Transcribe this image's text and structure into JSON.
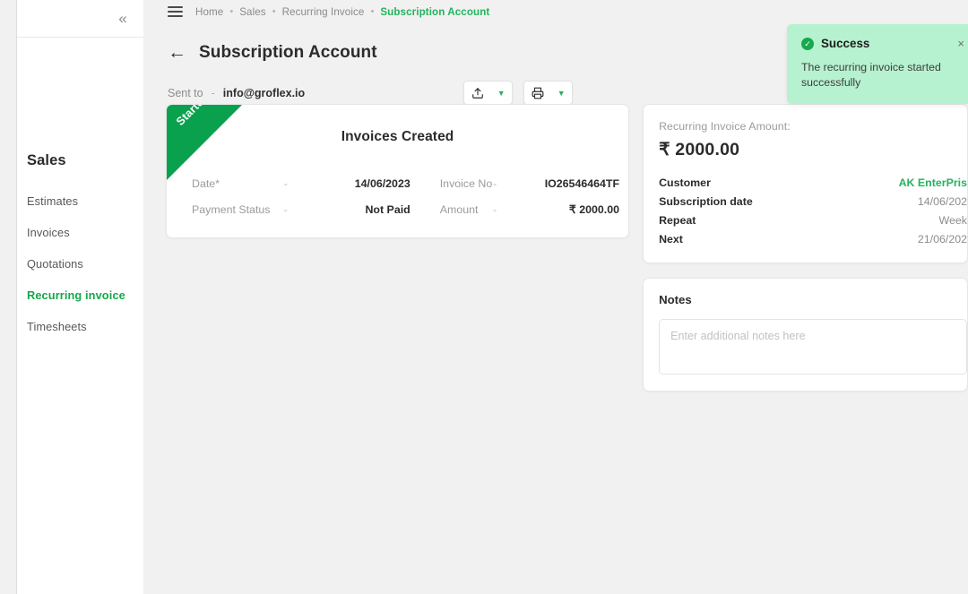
{
  "sidebar": {
    "collapse_icon": "chevron-double-left-icon",
    "section_title": "Sales",
    "items": [
      {
        "label": "Estimates",
        "active": false
      },
      {
        "label": "Invoices",
        "active": false
      },
      {
        "label": "Quotations",
        "active": false
      },
      {
        "label": "Recurring invoice",
        "active": true
      },
      {
        "label": "Timesheets",
        "active": false
      }
    ]
  },
  "topbar": {
    "menu_icon": "hamburger-icon",
    "breadcrumbs": [
      {
        "label": "Home",
        "active": false
      },
      {
        "label": "Sales",
        "active": false
      },
      {
        "label": "Recurring Invoice",
        "active": false
      },
      {
        "label": "Subscription Account",
        "active": true
      }
    ],
    "separator": "•"
  },
  "page": {
    "back_icon": "arrow-left-icon",
    "title": "Subscription Account",
    "sent_to_label": "Sent to",
    "sent_to_dash": "-",
    "sent_to_value": "info@groflex.io"
  },
  "actions": [
    {
      "icon": "upload-icon",
      "caret": "chevron-down-icon"
    },
    {
      "icon": "printer-icon",
      "caret": "chevron-down-icon"
    }
  ],
  "invoice_card": {
    "ribbon_label": "Started",
    "title": "Invoices Created",
    "rows": [
      {
        "label": "Date*",
        "dash": "-",
        "value": "14/06/2023",
        "label2": "Invoice No",
        "dash2": "-",
        "value2": "IO26546464TF"
      },
      {
        "label": "Payment Status",
        "dash": "-",
        "value": "Not Paid",
        "label2": "Amount",
        "dash2": "-",
        "value2": "₹ 2000.00"
      }
    ]
  },
  "summary": {
    "amount_label": "Recurring Invoice Amount:",
    "amount_value": "₹ 2000.00",
    "rows": [
      {
        "key": "Customer",
        "value": "AK EnterPris",
        "is_link": true
      },
      {
        "key": "Subscription date",
        "value": "14/06/202",
        "is_link": false
      },
      {
        "key": "Repeat",
        "value": "Week",
        "is_link": false
      },
      {
        "key": "Next",
        "value": "21/06/202",
        "is_link": false
      }
    ]
  },
  "notes": {
    "title": "Notes",
    "placeholder": "Enter additional notes here",
    "value": ""
  },
  "toast": {
    "check_icon": "check-circle-icon",
    "title": "Success",
    "message": "The recurring invoice started successfully",
    "close_icon": "close-icon",
    "close_label": "×",
    "background": "#b6f2cf",
    "accent": "#17a94f"
  },
  "theme": {
    "accent_green": "#14a84b",
    "ribbon_green": "#0aa14e",
    "page_background": "#f1f1f1"
  }
}
